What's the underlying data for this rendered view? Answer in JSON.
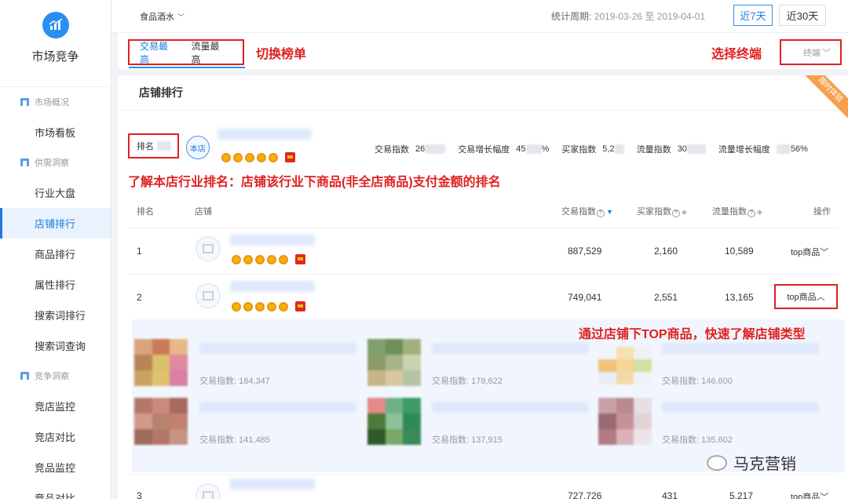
{
  "sidebar": {
    "title": "市场竞争",
    "groups": [
      {
        "label": "市场概况",
        "items": [
          "市场看板"
        ]
      },
      {
        "label": "供需洞察",
        "items": [
          "行业大盘",
          "店铺排行",
          "商品排行",
          "属性排行",
          "搜索词排行",
          "搜索词查询"
        ]
      },
      {
        "label": "竞争洞察",
        "items": [
          "竞店监控",
          "竞店对比",
          "竞品监控",
          "竞品对比"
        ]
      }
    ],
    "active_item": "店铺排行"
  },
  "topbar": {
    "category": "食品酒水",
    "period_label": "统计周期:",
    "period_dates": "2019-03-26 至 2019-04-01",
    "range_buttons": [
      "近7天",
      "近30天"
    ],
    "active_range": "近7天"
  },
  "tabs": {
    "items": [
      "交易最高",
      "流量最高"
    ],
    "active": "交易最高",
    "annotation": "切换榜单",
    "terminal_annotation": "选择终端",
    "terminal_select": "终端"
  },
  "card": {
    "title": "店铺排行",
    "ribbon": "限时体验",
    "my_rank_label": "排名",
    "store_badge": "本店",
    "my_metrics": [
      {
        "label": "交易指数",
        "value": "26"
      },
      {
        "label": "交易增长幅度",
        "value": "45",
        "suffix": "%"
      },
      {
        "label": "买家指数",
        "value": "5,2"
      },
      {
        "label": "流量指数",
        "value": "30"
      },
      {
        "label": "流量增长幅度",
        "value": "",
        "suffix": "56%"
      }
    ],
    "rank_annotation": "了解本店行业排名：店铺该行业下商品(非全店商品)支付金额的排名",
    "columns": [
      "排名",
      "店铺",
      "交易指数",
      "买家指数",
      "流量指数",
      "操作"
    ],
    "rows": [
      {
        "rank": "1",
        "trade": "887,529",
        "buyers": "2,160",
        "traffic": "10,589",
        "action": "top商品"
      },
      {
        "rank": "2",
        "trade": "749,041",
        "buyers": "2,551",
        "traffic": "13,165",
        "action": "top商品"
      },
      {
        "rank": "3",
        "trade": "727,726",
        "buyers": "431",
        "traffic": "5,217",
        "action": "top商品"
      }
    ],
    "top_annotation": "通过店铺下TOP商品，快速了解店铺类型",
    "product_trade_label": "交易指数:",
    "products": [
      {
        "trade": "184,347"
      },
      {
        "trade": "178,622"
      },
      {
        "trade": "146,600"
      },
      {
        "trade": "141,485"
      },
      {
        "trade": "137,915"
      },
      {
        "trade": "135,602"
      }
    ]
  },
  "watermark": "马克营销",
  "colors": {
    "accent": "#1f7ae0",
    "annotation_red": "#e02020",
    "ribbon": "#f5a04a"
  }
}
